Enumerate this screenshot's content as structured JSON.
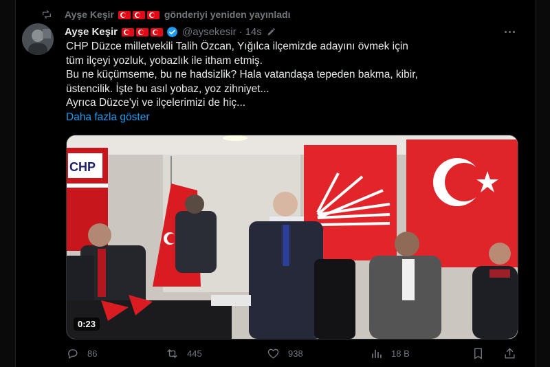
{
  "repost": {
    "text": "gönderiyi yeniden yayınladı",
    "user": "Ayşe Keşir"
  },
  "post": {
    "author": "Ayşe Keşir",
    "handle": "@aysekesir",
    "separator": "·",
    "time": "14s",
    "lines": [
      "CHP Düzce milletvekili Talih Özcan, Yığılca ilçemizde adayını övmek için",
      "tüm ilçeyi yozluk, yobazlık ile itham etmiş.",
      "Bu ne küçümseme, bu ne hadsizlik? Hala vatandaşa tepeden bakma, kibir,",
      "üstencilik. İşte bu asıl yobaz, yoz zihniyet...",
      "Ayrıca  Düzce'yi ve ilçelerimizi de hiç..."
    ],
    "show_more": "Daha fazla göster",
    "video_time": "0:23",
    "banner_text": "CHP"
  },
  "stats": {
    "replies": "86",
    "reposts": "445",
    "likes": "938",
    "views": "18 B"
  },
  "colors": {
    "accent": "#1d9bf0",
    "muted": "#71767b",
    "background": "#000000",
    "text": "#e7e9ea",
    "flag_red": "#e30a17"
  },
  "icons": {
    "repost": "repost-icon",
    "verified": "verified-badge-icon",
    "edit": "edit-pencil-icon",
    "more": "more-dots-icon",
    "reply": "reply-icon",
    "like": "heart-icon",
    "views": "views-bar-chart-icon",
    "bookmark": "bookmark-icon",
    "share": "share-icon"
  }
}
